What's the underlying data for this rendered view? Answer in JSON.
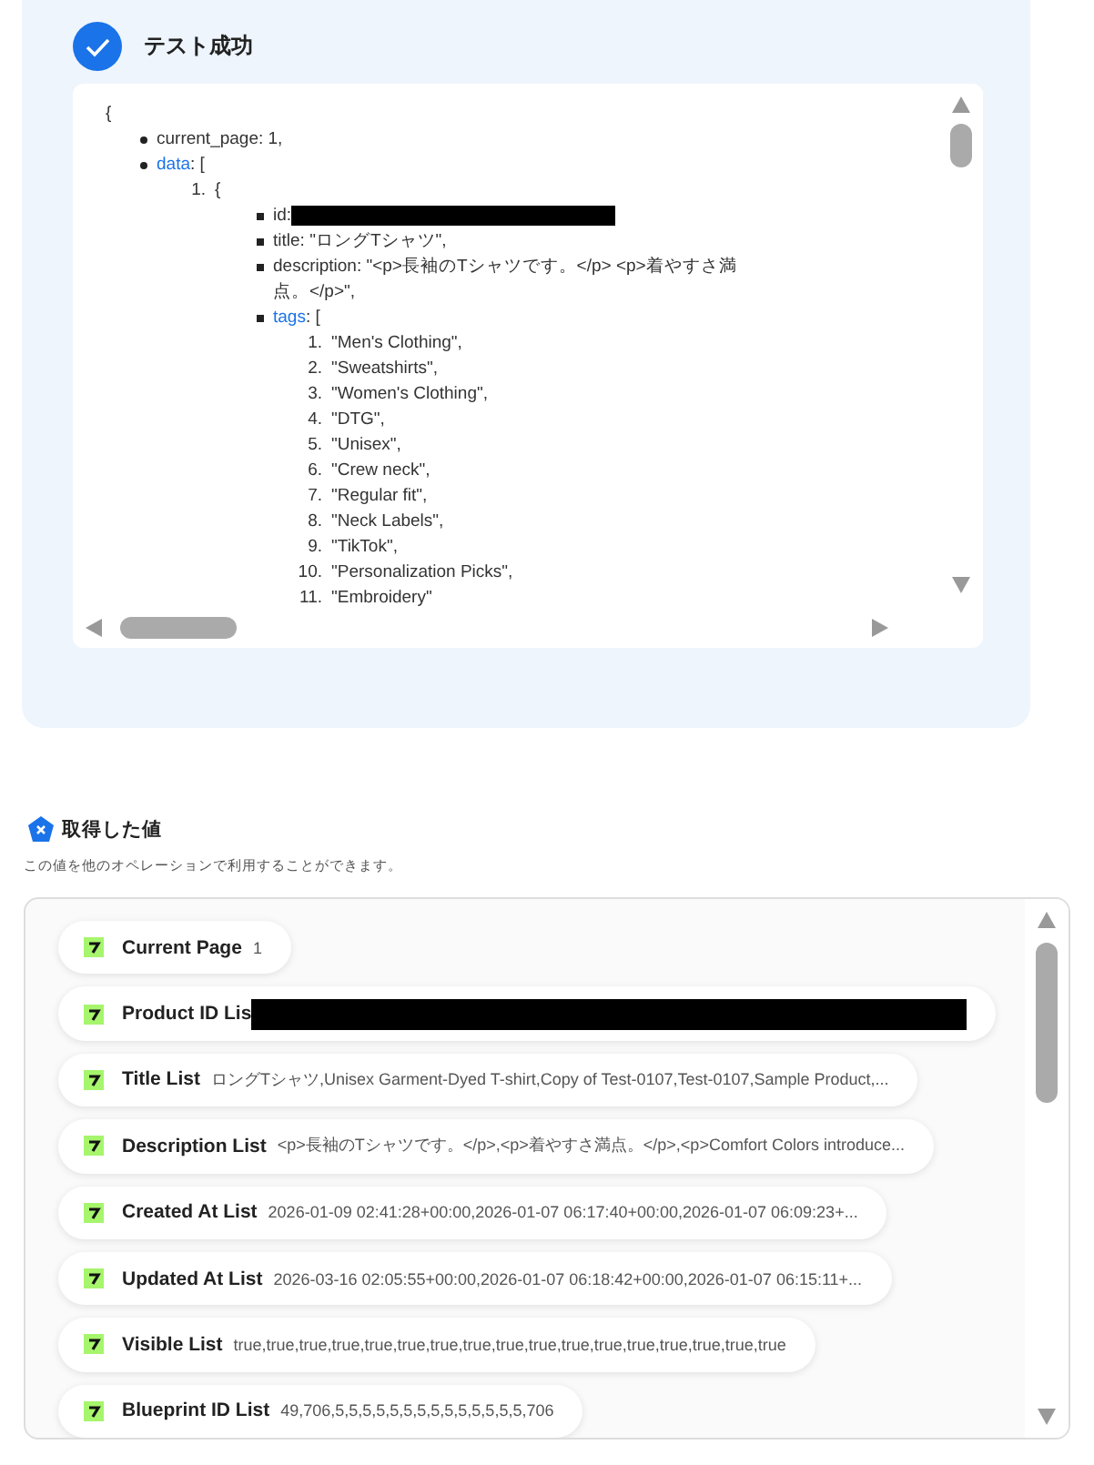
{
  "test_result": {
    "title": "テスト成功"
  },
  "code_view": {
    "open": "{",
    "items": [
      {
        "key": "current_page",
        "value": ": 1,",
        "link": false
      },
      {
        "key": "data",
        "value": ": [",
        "link": true,
        "children": [
          {
            "number": "1.",
            "value": "{",
            "children": [
              {
                "key": "id",
                "value": ":",
                "link": false,
                "redacted": true
              },
              {
                "key": "title",
                "value": ": \"ロングTシャツ\",",
                "link": false
              },
              {
                "key": "description",
                "value": ": \"<p>長袖のTシャツです。</p> <p>着やすさ満点。</p>\",",
                "link": false
              },
              {
                "key": "tags",
                "value": ": [",
                "link": true,
                "children": [
                  {
                    "number": "1.",
                    "value": "\"Men's Clothing\","
                  },
                  {
                    "number": "2.",
                    "value": "\"Sweatshirts\","
                  },
                  {
                    "number": "3.",
                    "value": "\"Women's Clothing\","
                  },
                  {
                    "number": "4.",
                    "value": "\"DTG\","
                  },
                  {
                    "number": "5.",
                    "value": "\"Unisex\","
                  },
                  {
                    "number": "6.",
                    "value": "\"Crew neck\","
                  },
                  {
                    "number": "7.",
                    "value": "\"Regular fit\","
                  },
                  {
                    "number": "8.",
                    "value": "\"Neck Labels\","
                  },
                  {
                    "number": "9.",
                    "value": "\"TikTok\","
                  },
                  {
                    "number": "10.",
                    "value": "\"Personalization Picks\","
                  },
                  {
                    "number": "11.",
                    "value": "\"Embroidery\""
                  }
                ]
              }
            ]
          }
        ]
      }
    ]
  },
  "outputs": {
    "title": "取得した値",
    "description": "この値を他のオペレーションで利用することができます。",
    "items": [
      {
        "label": "Current Page",
        "value": "1",
        "redacted": false
      },
      {
        "label": "Product ID Lis",
        "redacted": true
      },
      {
        "label": "Title List",
        "value": "ロングTシャツ,Unisex Garment-Dyed T-shirt,Copy of Test-0107,Test-0107,Sample Product,...",
        "redacted": false
      },
      {
        "label": "Description List",
        "value": "<p>長袖のTシャツです。</p>,<p>着やすさ満点。</p>,<p>Comfort Colors introduce...",
        "redacted": false
      },
      {
        "label": "Created At List",
        "value": "2026-01-09 02:41:28+00:00,2026-01-07 06:17:40+00:00,2026-01-07 06:09:23+...",
        "redacted": false
      },
      {
        "label": "Updated At List",
        "value": "2026-03-16 02:05:55+00:00,2026-01-07 06:18:42+00:00,2026-01-07 06:15:11+...",
        "redacted": false
      },
      {
        "label": "Visible List",
        "value": "true,true,true,true,true,true,true,true,true,true,true,true,true,true,true,true,true",
        "redacted": false
      },
      {
        "label": "Blueprint ID List",
        "value": "49,706,5,5,5,5,5,5,5,5,5,5,5,5,5,5,706",
        "redacted": false
      }
    ]
  }
}
